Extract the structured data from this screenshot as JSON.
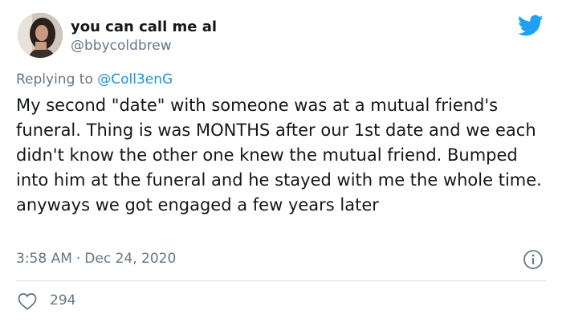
{
  "author": {
    "display_name": "you can call me al",
    "handle": "@bbycoldbrew"
  },
  "reply": {
    "prefix": "Replying to",
    "mention": "@Coll3enG"
  },
  "tweet": {
    "text": "My second \"date\" with someone was at a mutual friend's funeral. Thing is was MONTHS after our 1st date and we each didn't know the other one knew the mutual friend. Bumped into him at the funeral and he stayed with me the whole time. anyways we got engaged a few years later",
    "time": "3:58 AM",
    "separator": "·",
    "date": "Dec 24, 2020"
  },
  "engagement": {
    "likes": "294"
  },
  "icons": {
    "brand": "twitter-bird-icon",
    "info": "info-icon",
    "like": "heart-icon"
  },
  "colors": {
    "brand_blue": "#1da1f2",
    "link_blue": "#1b95e0",
    "secondary_text": "#657786",
    "divider": "#d5dde3"
  }
}
